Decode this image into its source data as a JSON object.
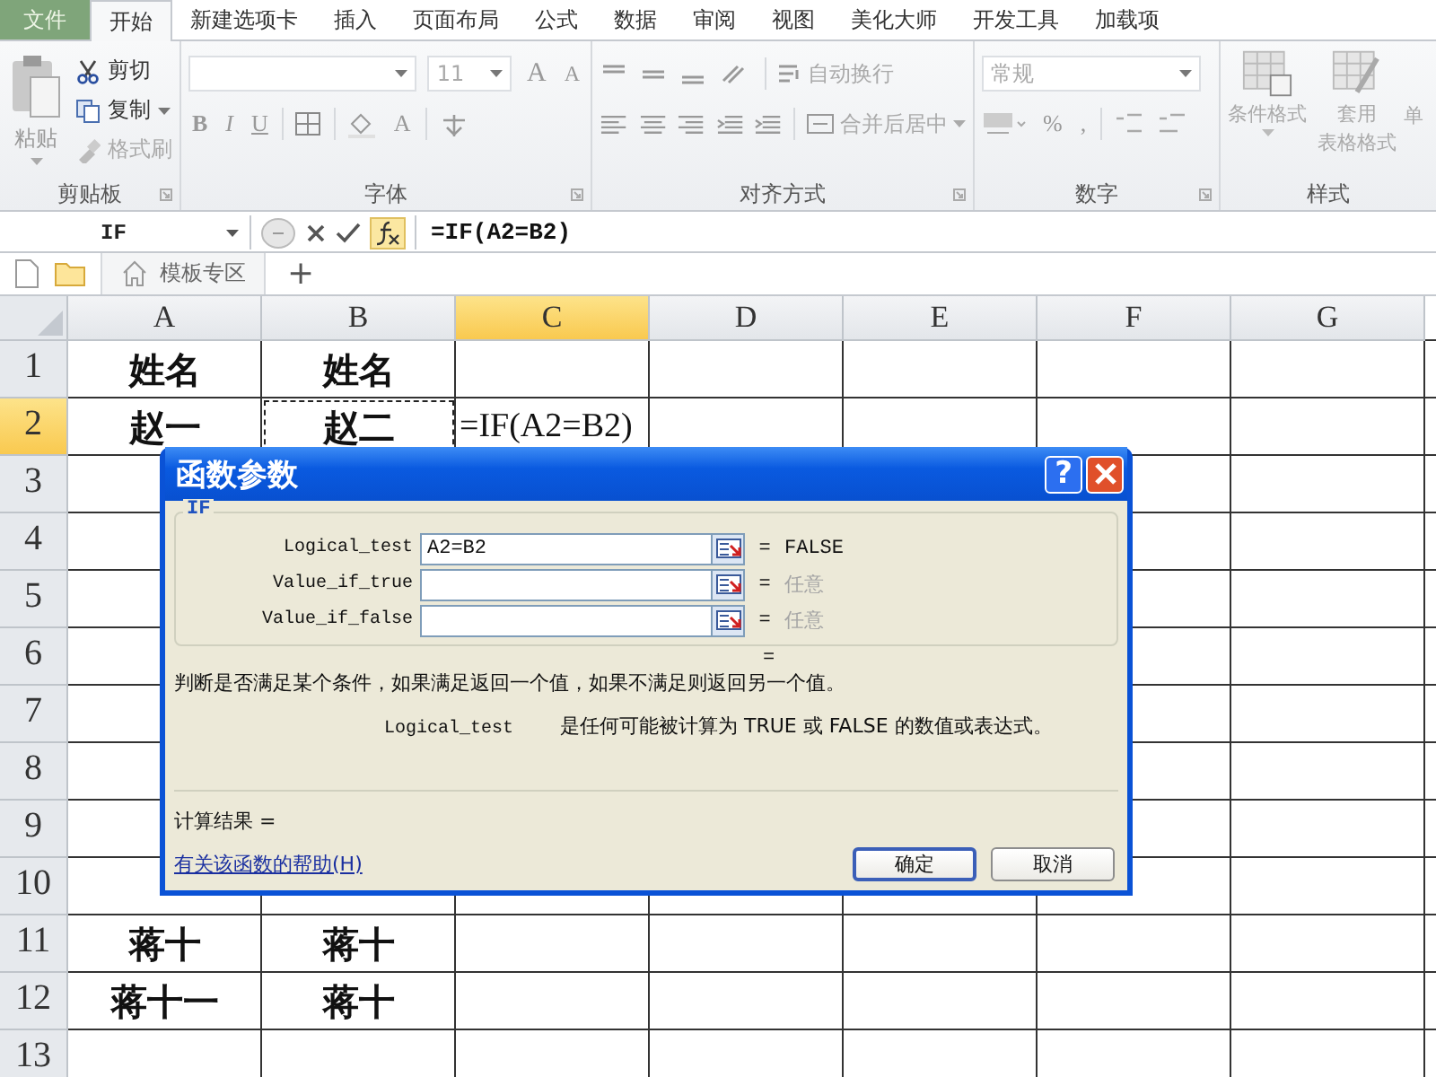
{
  "menu_tabs": [
    {
      "label": "文件",
      "kind": "file",
      "selected": false
    },
    {
      "label": "开始",
      "kind": "tab",
      "selected": true
    },
    {
      "label": "新建选项卡",
      "kind": "tab",
      "selected": false
    },
    {
      "label": "插入",
      "kind": "tab",
      "selected": false
    },
    {
      "label": "页面布局",
      "kind": "tab",
      "selected": false
    },
    {
      "label": "公式",
      "kind": "tab",
      "selected": false
    },
    {
      "label": "数据",
      "kind": "tab",
      "selected": false
    },
    {
      "label": "审阅",
      "kind": "tab",
      "selected": false
    },
    {
      "label": "视图",
      "kind": "tab",
      "selected": false
    },
    {
      "label": "美化大师",
      "kind": "tab",
      "selected": false
    },
    {
      "label": "开发工具",
      "kind": "tab",
      "selected": false
    },
    {
      "label": "加载项",
      "kind": "tab",
      "selected": false
    }
  ],
  "ribbon": {
    "clipboard": {
      "title": "剪贴板",
      "paste": "粘贴",
      "items": [
        {
          "label": "剪切",
          "kind": "cut",
          "disabled": false
        },
        {
          "label": "复制",
          "kind": "copy",
          "disabled": false
        },
        {
          "label": "格式刷",
          "kind": "brush",
          "disabled": true
        }
      ]
    },
    "font": {
      "title": "字体",
      "size": "11",
      "grow": "A",
      "shrink": "A",
      "bold": "B",
      "italic": "I",
      "underline": "U",
      "font_color": "A"
    },
    "alignment": {
      "title": "对齐方式",
      "wrap_text": "自动换行",
      "merge_center": "合并后居中"
    },
    "number": {
      "title": "数字",
      "format": "常规",
      "percent": "%",
      "comma": ","
    },
    "styles": {
      "title": "样式",
      "conditional": "条件格式",
      "table_format": [
        "套用",
        "表格格式"
      ],
      "cell_styles": "单"
    }
  },
  "formula_bar": {
    "name_box": "IF",
    "formula": "=IF(A2=B2)"
  },
  "doc_tabs": {
    "tab": "模板专区",
    "add": "+"
  },
  "sheet": {
    "columns": [
      {
        "label": "A",
        "selected": false
      },
      {
        "label": "B",
        "selected": false
      },
      {
        "label": "C",
        "selected": true
      },
      {
        "label": "D",
        "selected": false
      },
      {
        "label": "E",
        "selected": false
      },
      {
        "label": "F",
        "selected": false
      },
      {
        "label": "G",
        "selected": false
      }
    ],
    "rows": [
      {
        "label": "1",
        "selected": false,
        "cells": {
          "A": {
            "text": "姓名",
            "marquee": false
          },
          "B": {
            "text": "姓名",
            "marquee": false
          }
        }
      },
      {
        "label": "2",
        "selected": true,
        "cells": {
          "A": {
            "text": "赵一",
            "marquee": false
          },
          "B": {
            "text": "赵二",
            "marquee": true
          },
          "C": {
            "text": "=IF(A2=B2)",
            "marquee": false
          }
        }
      },
      {
        "label": "3",
        "selected": false
      },
      {
        "label": "4",
        "selected": false
      },
      {
        "label": "5",
        "selected": false
      },
      {
        "label": "6",
        "selected": false
      },
      {
        "label": "7",
        "selected": false
      },
      {
        "label": "8",
        "selected": false
      },
      {
        "label": "9",
        "selected": false
      },
      {
        "label": "10",
        "selected": false
      },
      {
        "label": "11",
        "selected": false,
        "cells": {
          "A": {
            "text": "蒋十",
            "marquee": false
          },
          "B": {
            "text": "蒋十",
            "marquee": false
          }
        }
      },
      {
        "label": "12",
        "selected": false,
        "cells": {
          "A": {
            "text": "蒋十一",
            "marquee": false
          },
          "B": {
            "text": "蒋十",
            "marquee": false
          }
        }
      },
      {
        "label": "13",
        "selected": false
      }
    ]
  },
  "dialog": {
    "title": "函数参数",
    "help": "?",
    "group": "IF",
    "args": [
      {
        "name": "Logical_test",
        "value": "A2=B2",
        "equals": "=",
        "result": "FALSE",
        "muted": false
      },
      {
        "name": "Value_if_true",
        "equals": "=",
        "result": "任意",
        "muted": true
      },
      {
        "name": "Value_if_false",
        "equals": "=",
        "result": "任意",
        "muted": true
      }
    ],
    "formula_equals": "=",
    "description": "判断是否满足某个条件，如果满足返回一个值，如果不满足则返回另一个值。",
    "arg_name": "Logical_test",
    "arg_description": "是任何可能被计算为 TRUE 或 FALSE 的数值或表达式。",
    "result_label": "计算结果 =",
    "help_link": "有关该函数的帮助(H)",
    "buttons": [
      {
        "label": "确定",
        "default": true
      },
      {
        "label": "取消",
        "default": false
      }
    ]
  }
}
